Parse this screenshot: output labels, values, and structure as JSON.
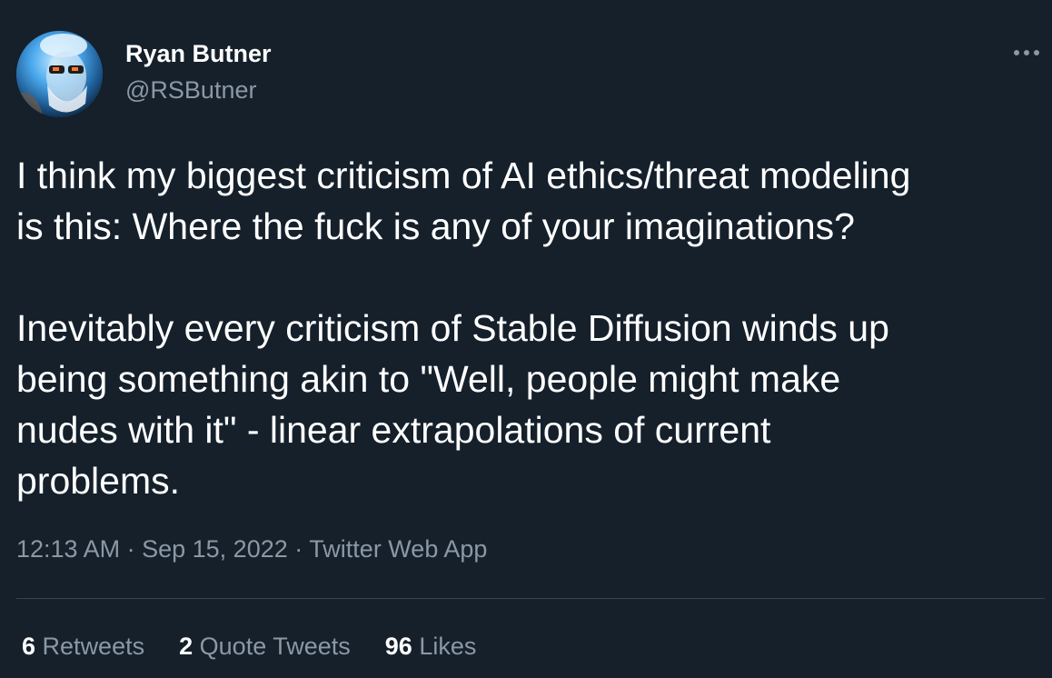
{
  "author": {
    "name": "Ryan Butner",
    "handle": "@RSButner"
  },
  "tweet": {
    "paragraph1": [
      "I think my biggest criticism of AI ethics/threat modeling",
      "is this:  Where the fuck is any of your imaginations?"
    ],
    "paragraph2": [
      "Inevitably every criticism of Stable Diffusion winds up",
      "being something akin to \"Well, people might make",
      "nudes with it\" - linear extrapolations of current",
      "problems."
    ]
  },
  "meta": {
    "time": "12:13 AM",
    "date": "Sep 15, 2022",
    "source": "Twitter Web App",
    "separator": "·"
  },
  "stats": {
    "retweets_count": "6",
    "retweets_label": "Retweets",
    "quotes_count": "2",
    "quotes_label": "Quote Tweets",
    "likes_count": "96",
    "likes_label": "Likes"
  },
  "icons": {
    "more": "more-horizontal-icon"
  },
  "colors": {
    "background": "#15202b",
    "text_primary": "#ffffff",
    "text_secondary": "#8b98a5",
    "divider": "#38444d"
  }
}
